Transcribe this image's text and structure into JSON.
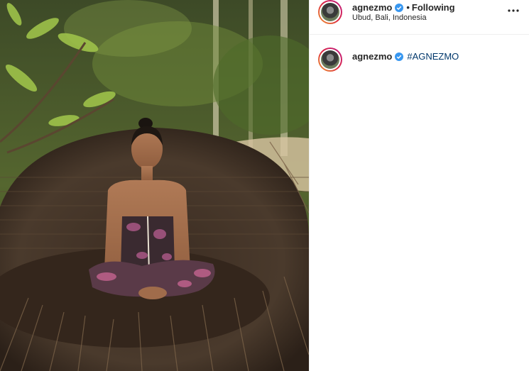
{
  "post": {
    "username": "agnezmo",
    "follow_separator": "•",
    "follow_status": "Following",
    "location": "Ubud, Bali, Indonesia",
    "more_icon": "more-horizontal-icon",
    "verified_icon": "verified-badge-icon"
  },
  "caption": {
    "username": "agnezmo",
    "hashtag": "#AGNEZMO"
  },
  "colors": {
    "verified": "#3897f0",
    "hashtag": "#00376b",
    "border": "#efefef"
  }
}
